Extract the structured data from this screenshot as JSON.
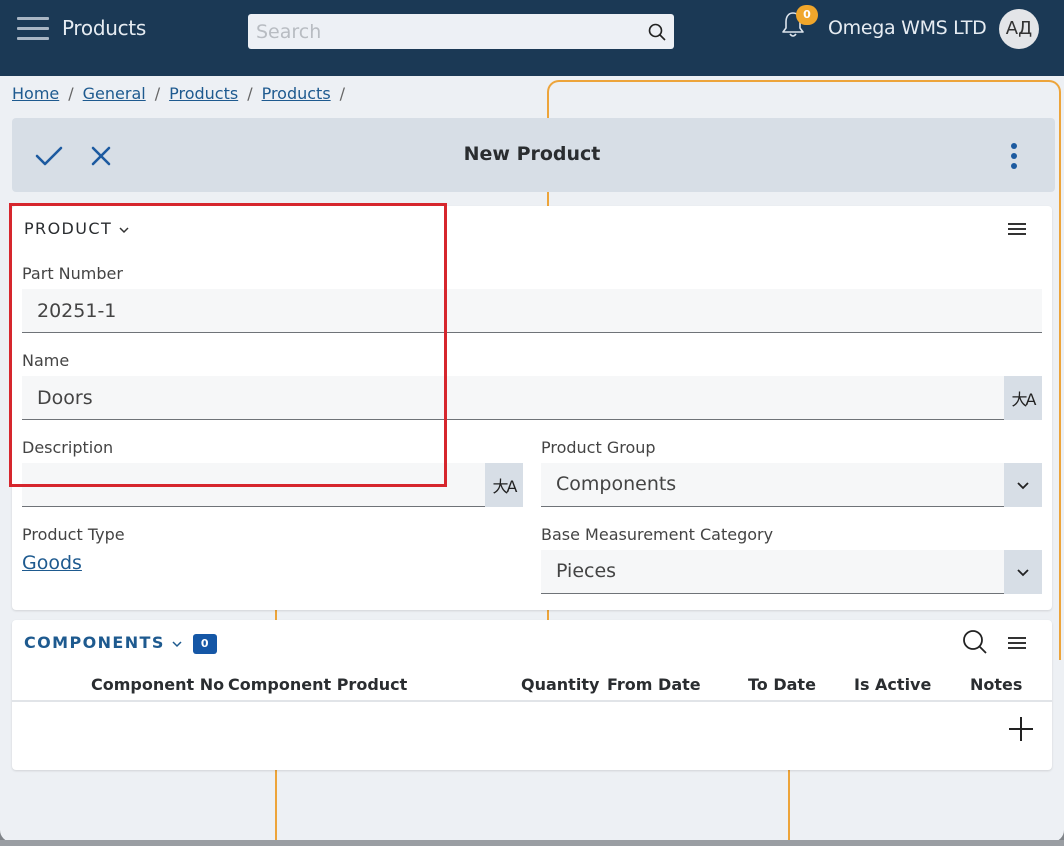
{
  "header": {
    "app_title": "Products",
    "search_placeholder": "Search",
    "search_value": "",
    "notification_count": "0",
    "company_name": "Omega WMS LTD",
    "avatar_initials": "АД"
  },
  "breadcrumb": {
    "items": [
      {
        "label": "Home"
      },
      {
        "label": "General"
      },
      {
        "label": "Products"
      },
      {
        "label": "Products"
      }
    ],
    "separator": "/"
  },
  "action_bar": {
    "title": "New Product",
    "confirm_icon": "check-icon",
    "cancel_icon": "close-icon",
    "more_icon": "more-vertical-icon"
  },
  "product_section": {
    "title": "PRODUCT",
    "fields": {
      "part_number": {
        "label": "Part Number",
        "value": "20251-1"
      },
      "name": {
        "label": "Name",
        "value": "Doors",
        "translate_icon": "translate-icon"
      },
      "description": {
        "label": "Description",
        "value": "",
        "translate_icon": "translate-icon"
      },
      "product_group": {
        "label": "Product Group",
        "value": "Components"
      },
      "product_type": {
        "label": "Product Type",
        "value": "Goods"
      },
      "base_measurement_category": {
        "label": "Base Measurement Category",
        "value": "Pieces"
      }
    }
  },
  "components_section": {
    "title": "COMPONENTS",
    "count": "0",
    "columns": [
      "Component No",
      "Component Product",
      "Quantity",
      "From Date",
      "To Date",
      "Is Active",
      "Notes"
    ],
    "rows": []
  },
  "colors": {
    "header_bg": "#1b3955",
    "accent": "#1557a6",
    "link": "#1e5a8f",
    "badge_orange": "#f0a62b",
    "highlight_red": "#d6262d",
    "overlay_orange": "#eda43a"
  }
}
